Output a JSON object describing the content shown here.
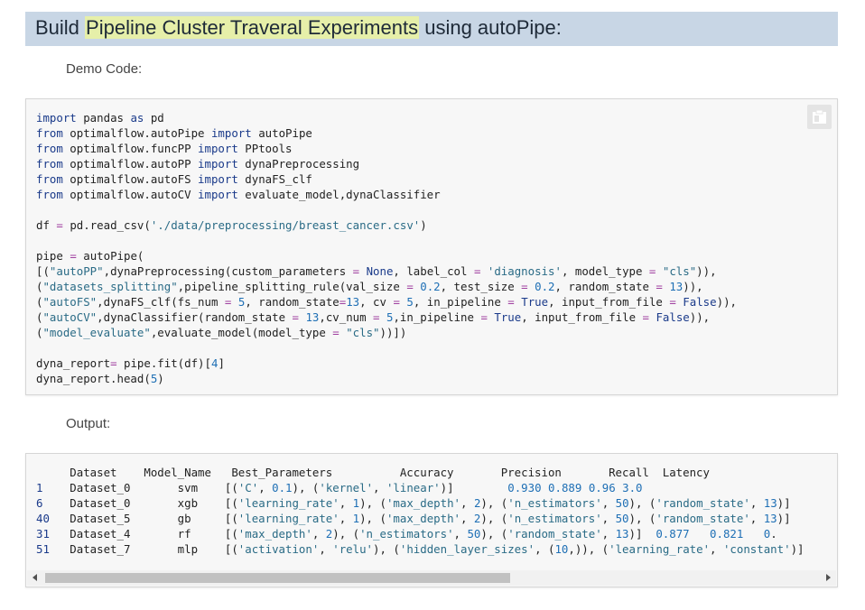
{
  "heading": {
    "prefix": "Build ",
    "highlight": "Pipeline Cluster Traveral Experiments",
    "suffix": " using autoPipe:"
  },
  "labels": {
    "demo_code": "Demo Code:",
    "output": "Output:"
  },
  "code_lines": [
    "import pandas as pd",
    "from optimalflow.autoPipe import autoPipe",
    "from optimalflow.funcPP import PPtools",
    "from optimalflow.autoPP import dynaPreprocessing",
    "from optimalflow.autoFS import dynaFS_clf",
    "from optimalflow.autoCV import evaluate_model,dynaClassifier",
    "",
    "df = pd.read_csv('./data/preprocessing/breast_cancer.csv')",
    "",
    "pipe = autoPipe(",
    "[(\"autoPP\",dynaPreprocessing(custom_parameters = None, label_col = 'diagnosis', model_type = \"cls\")),",
    "(\"datasets_splitting\",pipeline_splitting_rule(val_size = 0.2, test_size = 0.2, random_state = 13)),",
    "(\"autoFS\",dynaFS_clf(fs_num = 5, random_state=13, cv = 5, in_pipeline = True, input_from_file = False)),",
    "(\"autoCV\",dynaClassifier(random_state = 13,cv_num = 5,in_pipeline = True, input_from_file = False)),",
    "(\"model_evaluate\",evaluate_model(model_type = \"cls\"))])",
    "",
    "dyna_report= pipe.fit(df)[4]",
    "dyna_report.head(5)"
  ],
  "output_lines": [
    "     Dataset    Model_Name   Best_Parameters          Accuracy       Precision       Recall  Latency",
    "1    Dataset_0       svm    [('C', 0.1), ('kernel', 'linear')]        0.930 0.889 0.96 3.0",
    "6    Dataset_0       xgb    [('learning_rate', 1), ('max_depth', 2), ('n_estimators', 50), ('random_state', 13)]",
    "40   Dataset_5       gb     [('learning_rate', 1), ('max_depth', 2), ('n_estimators', 50), ('random_state', 13)]",
    "31   Dataset_4       rf     [('max_depth', 2), ('n_estimators', 50), ('random_state', 13)]  0.877   0.821   0.",
    "51   Dataset_7       mlp    [('activation', 'relu'), ('hidden_layer_sizes', (10,)), ('learning_rate', 'constant')]"
  ],
  "icons": {
    "copy": "copy-icon"
  },
  "colors": {
    "heading_bg": "#c8d6e5",
    "highlight": "#e6efa9",
    "code_bg": "#f7f7f7"
  }
}
